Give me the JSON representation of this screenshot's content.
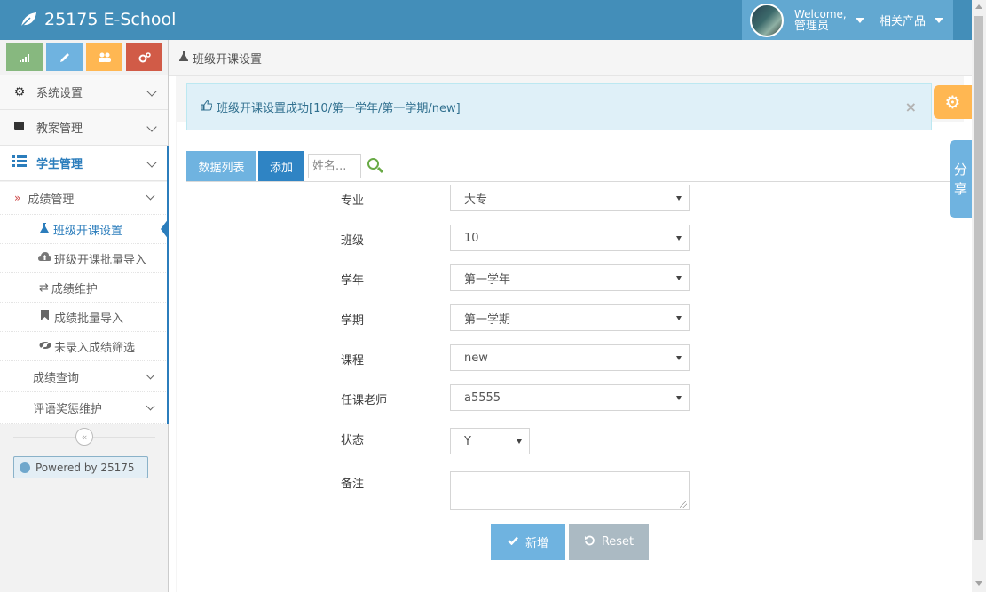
{
  "app": {
    "title": "25175 E-School"
  },
  "header": {
    "welcome": "Welcome,",
    "username": "管理员",
    "products": "相关产品"
  },
  "sidebar": {
    "shortcut_colors": [
      "#87b87f",
      "#6fb3e0",
      "#ffb752",
      "#d15b47"
    ],
    "items": [
      {
        "label": "系统设置",
        "icon": "gear-icon"
      },
      {
        "label": "教案管理",
        "icon": "book-icon"
      },
      {
        "label": "学生管理",
        "icon": "list-icon"
      }
    ],
    "sub_group": {
      "label": "成绩管理"
    },
    "sub_items": [
      {
        "label": "班级开课设置",
        "icon": "flask-icon"
      },
      {
        "label": "班级开课批量导入",
        "icon": "cloud-upload-icon"
      },
      {
        "label": "成绩维护",
        "icon": "exchange-icon"
      },
      {
        "label": "成绩批量导入",
        "icon": "bookmark-icon"
      },
      {
        "label": "未录入成绩筛选",
        "icon": "eye-slash-icon"
      }
    ],
    "more_items": [
      {
        "label": "成绩查询"
      },
      {
        "label": "评语奖惩维护"
      }
    ],
    "powered": "Powered by 25175"
  },
  "breadcrumb": {
    "current": "班级开课设置"
  },
  "alert": {
    "message": "班级开课设置成功[10/第一学年/第一学期/new]"
  },
  "toolbar": {
    "list_label": "数据列表",
    "add_label": "添加",
    "name_placeholder": "姓名..."
  },
  "form": {
    "fields": [
      {
        "label": "专业",
        "value": "大专"
      },
      {
        "label": "班级",
        "value": "10"
      },
      {
        "label": "学年",
        "value": "第一学年"
      },
      {
        "label": "学期",
        "value": "第一学期"
      },
      {
        "label": "课程",
        "value": "new"
      },
      {
        "label": "任课老师",
        "value": "a5555"
      },
      {
        "label": "状态",
        "value": "Y"
      }
    ],
    "remark_label": "备注",
    "submit_label": "新增",
    "reset_label": "Reset"
  },
  "share": {
    "chars": [
      "分",
      "享"
    ]
  },
  "colors": {
    "navbar": "#438eb9",
    "navbar_highlight": "#62a8d1",
    "primary": "#6fb3e0",
    "primary_dark": "#2f84c4",
    "warning": "#ffb752",
    "success": "#87b87f",
    "danger": "#d15b47",
    "reset": "#abbac3"
  }
}
